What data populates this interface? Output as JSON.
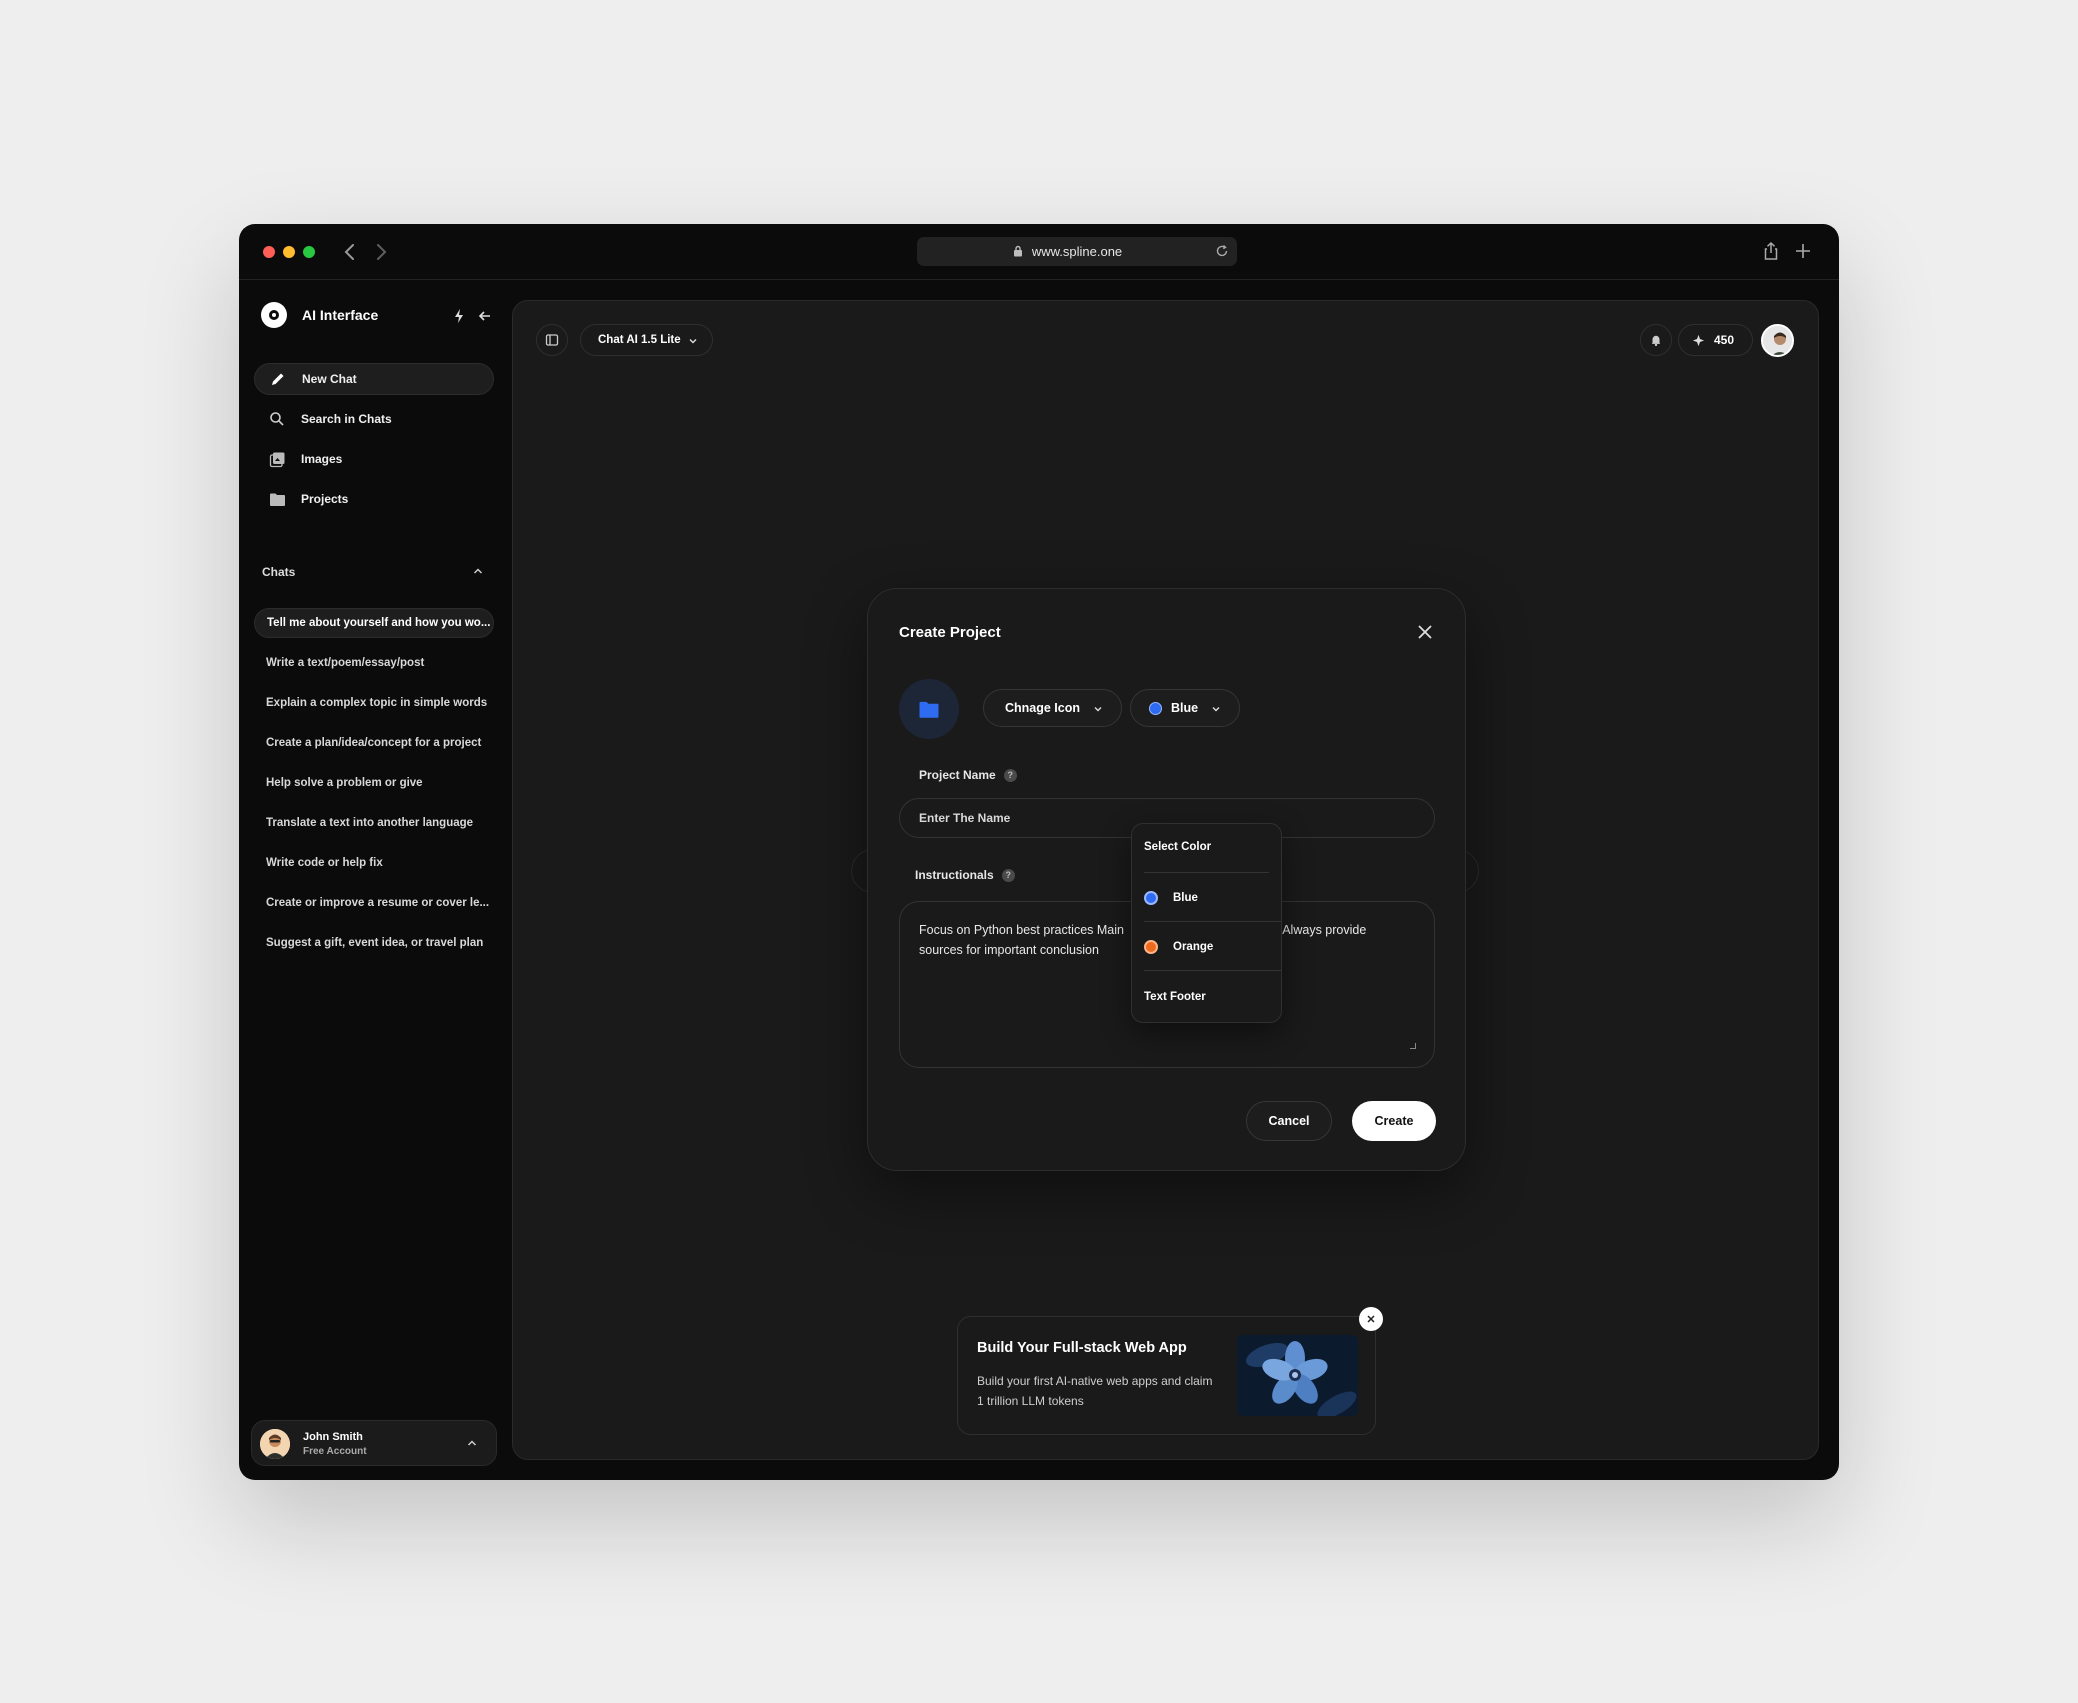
{
  "browser": {
    "url": "www.spline.one",
    "traffic_lights": [
      "#ff5f57",
      "#febc2e",
      "#28c840"
    ]
  },
  "sidebar": {
    "app_name": "AI Interface",
    "menu": [
      {
        "label": "New Chat",
        "icon": "pencil-icon"
      },
      {
        "label": "Search in Chats",
        "icon": "search-icon"
      },
      {
        "label": "Images",
        "icon": "images-icon"
      },
      {
        "label": "Projects",
        "icon": "folder-icon"
      }
    ],
    "chats_header": "Chats",
    "chats": [
      "Tell me about yourself and how you wo...",
      "Write a text/poem/essay/post",
      "Explain a complex topic in simple words",
      "Create a plan/idea/concept for a project",
      "Help solve a problem or give",
      "Translate a text into another language",
      "Write code or help fix",
      "Create or improve a resume or cover le...",
      "Suggest a gift, event idea, or travel plan"
    ],
    "user": {
      "name": "John Smith",
      "plan": "Free Account"
    }
  },
  "topbar": {
    "model": "Chat AI 1.5 Lite",
    "credits": "450"
  },
  "modal": {
    "title": "Create Project",
    "change_icon_label": "Chnage Icon",
    "color_label": "Blue",
    "project_name_label": "Project Name",
    "project_name_placeholder": "Enter The Name",
    "instructions_label": "Instructionals",
    "instructions_text": "Focus on Python best practices Main",
    "instructions_text_tail": ". Always provide",
    "instructions_text_line2": "sources for important conclusion",
    "cancel_label": "Cancel",
    "create_label": "Create",
    "help_glyph": "?"
  },
  "color_dropdown": {
    "title": "Select Color",
    "options": [
      {
        "label": "Blue",
        "color": "#2f6bf0"
      },
      {
        "label": "Orange",
        "color": "#f06a1d"
      }
    ],
    "footer": "Text Footer"
  },
  "promo": {
    "title": "Build Your Full-stack Web App",
    "description": "Build your first AI-native web apps and claim 1 trillion LLM tokens"
  },
  "colors": {
    "accent_blue": "#2f6bf0",
    "accent_orange": "#f06a1d",
    "background": "#1a1a1a"
  }
}
